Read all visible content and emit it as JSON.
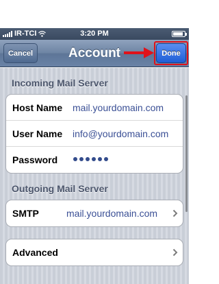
{
  "status_bar": {
    "carrier": "IR-TCI",
    "time": "3:20 PM"
  },
  "navbar": {
    "title": "Account",
    "cancel_label": "Cancel",
    "done_label": "Done"
  },
  "incoming": {
    "header": "Incoming Mail Server",
    "rows": [
      {
        "label": "Host Name",
        "value": "mail.yourdomain.com"
      },
      {
        "label": "User Name",
        "value": "info@yourdomain.com"
      },
      {
        "label": "Password"
      }
    ]
  },
  "outgoing": {
    "header": "Outgoing Mail Server",
    "smtp_label": "SMTP",
    "smtp_value": "mail.yourdomain.com"
  },
  "advanced": {
    "label": "Advanced"
  },
  "colors": {
    "highlight": "#e0121a",
    "value_text": "#3a4f95",
    "done_button": "#1e5ed6"
  },
  "password_dot_count": 6
}
